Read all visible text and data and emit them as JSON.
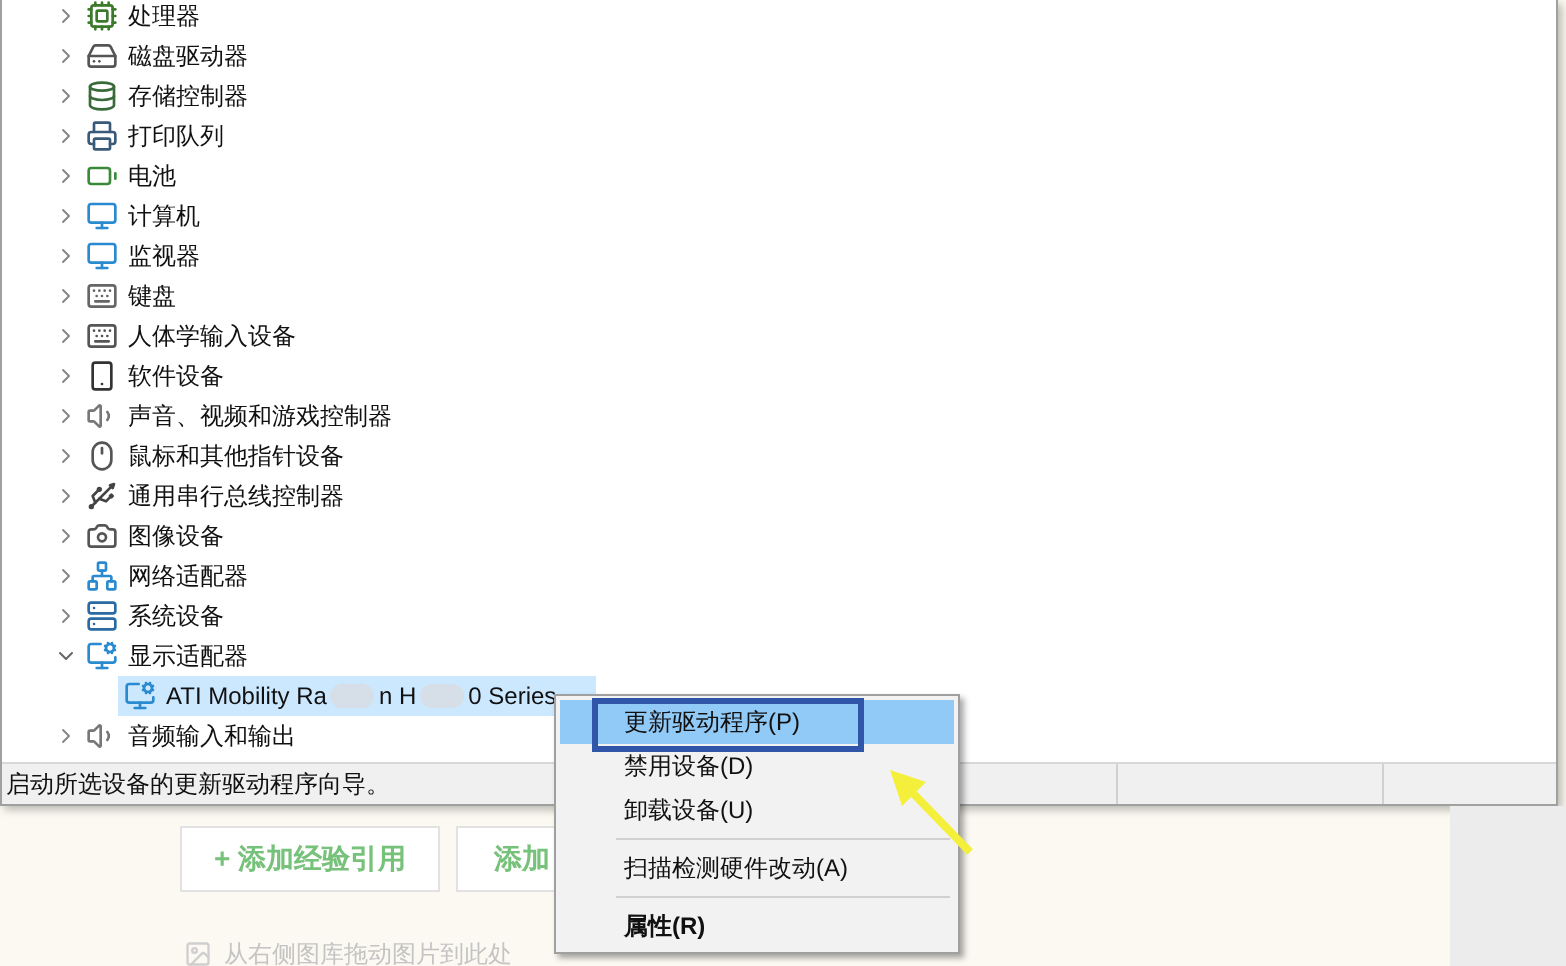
{
  "device_tree": {
    "items": [
      {
        "label": "处理器",
        "expanded": false,
        "selected": false
      },
      {
        "label": "磁盘驱动器",
        "expanded": false,
        "selected": false
      },
      {
        "label": "存储控制器",
        "expanded": false,
        "selected": false
      },
      {
        "label": "打印队列",
        "expanded": false,
        "selected": false
      },
      {
        "label": "电池",
        "expanded": false,
        "selected": false
      },
      {
        "label": "计算机",
        "expanded": false,
        "selected": false
      },
      {
        "label": "监视器",
        "expanded": false,
        "selected": false
      },
      {
        "label": "键盘",
        "expanded": false,
        "selected": false
      },
      {
        "label": "人体学输入设备",
        "expanded": false,
        "selected": false
      },
      {
        "label": "软件设备",
        "expanded": false,
        "selected": false
      },
      {
        "label": "声音、视频和游戏控制器",
        "expanded": false,
        "selected": false
      },
      {
        "label": "鼠标和其他指针设备",
        "expanded": false,
        "selected": false
      },
      {
        "label": "通用串行总线控制器",
        "expanded": false,
        "selected": false
      },
      {
        "label": "图像设备",
        "expanded": false,
        "selected": false
      },
      {
        "label": "网络适配器",
        "expanded": false,
        "selected": false
      },
      {
        "label": "系统设备",
        "expanded": false,
        "selected": false
      },
      {
        "label": "显示适配器",
        "expanded": true,
        "selected": false,
        "children": [
          {
            "label_parts": [
              "ATI Mobility Ra",
              "n H",
              "0 Series"
            ],
            "selected": true
          }
        ]
      },
      {
        "label": "音频输入和输出",
        "expanded": false,
        "selected": false
      }
    ]
  },
  "status_bar": {
    "text": "启动所选设备的更新驱动程序向导。"
  },
  "context_menu": {
    "items": [
      {
        "label": "更新驱动程序(P)",
        "selected": true,
        "outlined": true,
        "default": false,
        "separator_after": false
      },
      {
        "label": "禁用设备(D)",
        "selected": false,
        "outlined": false,
        "default": false,
        "separator_after": false
      },
      {
        "label": "卸载设备(U)",
        "selected": false,
        "outlined": false,
        "default": false,
        "separator_after": true
      },
      {
        "label": "扫描检测硬件改动(A)",
        "selected": false,
        "outlined": false,
        "default": false,
        "separator_after": true
      },
      {
        "label": "属性(R)",
        "selected": false,
        "outlined": false,
        "default": true,
        "separator_after": false
      }
    ]
  },
  "page": {
    "buttons": [
      "+ 添加经验引用",
      "添加"
    ],
    "drop_hint": "从右侧图库拖动图片到此处"
  }
}
